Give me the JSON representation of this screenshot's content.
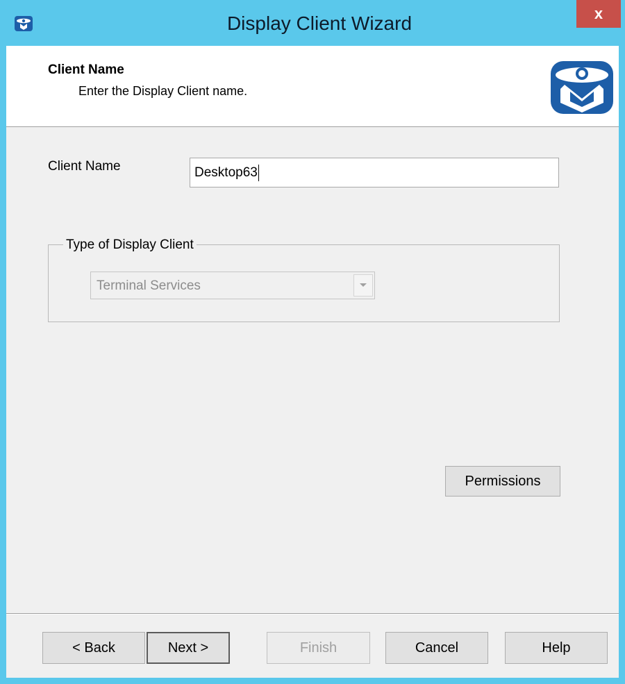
{
  "window": {
    "title": "Display Client Wizard",
    "close_label": "x",
    "app_icon": "thinmanager-logo-icon"
  },
  "header": {
    "title": "Client Name",
    "subtitle": "Enter the Display Client name.",
    "logo_icon": "thinmanager-logo-icon"
  },
  "form": {
    "client_name_label": "Client Name",
    "client_name_value": "Desktop63",
    "type_group_label": "Type of Display Client",
    "type_value": "Terminal Services",
    "type_disabled": true,
    "permissions_button": "Permissions"
  },
  "buttons": {
    "back": "< Back",
    "next": "Next >",
    "finish": "Finish",
    "cancel": "Cancel",
    "help": "Help"
  },
  "colors": {
    "titlebar": "#5ac8eb",
    "close_button": "#c7504a",
    "logo_blue": "#1d5ea8"
  }
}
